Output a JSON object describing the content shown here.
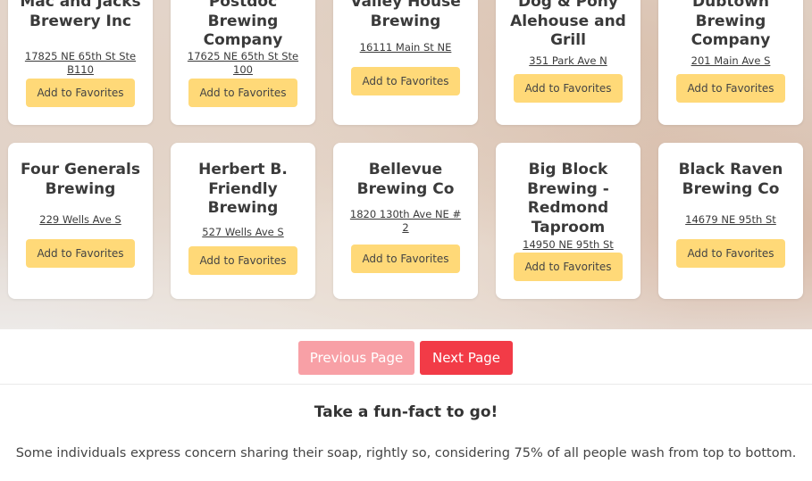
{
  "cards": [
    {
      "name": "Mac and Jacks Brewery Inc",
      "address": "17825 NE 65th St Ste B110",
      "button": "Add to Favorites"
    },
    {
      "name": "Postdoc Brewing Company",
      "address": "17625 NE 65th St Ste 100",
      "button": "Add to Favorites"
    },
    {
      "name": "Valley House Brewing",
      "address": "16111 Main St NE",
      "button": "Add to Favorites"
    },
    {
      "name": "Dog & Pony Alehouse and Grill",
      "address": "351 Park Ave N",
      "button": "Add to Favorites"
    },
    {
      "name": "Dubtown Brewing Company",
      "address": "201 Main Ave S",
      "button": "Add to Favorites"
    },
    {
      "name": "Four Generals Brewing",
      "address": "229 Wells Ave S",
      "button": "Add to Favorites"
    },
    {
      "name": "Herbert B. Friendly Brewing",
      "address": "527 Wells Ave S",
      "button": "Add to Favorites"
    },
    {
      "name": "Bellevue Brewing Co",
      "address": "1820 130th Ave NE # 2",
      "button": "Add to Favorites"
    },
    {
      "name": "Big Block Brewing - Redmond Taproom",
      "address": "14950 NE 95th St",
      "button": "Add to Favorites"
    },
    {
      "name": "Black Raven Brewing Co",
      "address": "14679 NE 95th St",
      "button": "Add to Favorites"
    }
  ],
  "pagination": {
    "previous_label": "Previous Page",
    "next_label": "Next Page"
  },
  "fun_fact": {
    "title": "Take a fun-fact to go!",
    "text": "Some individuals express concern sharing their soap, rightly so, considering 75% of all people wash from top to bottom."
  }
}
